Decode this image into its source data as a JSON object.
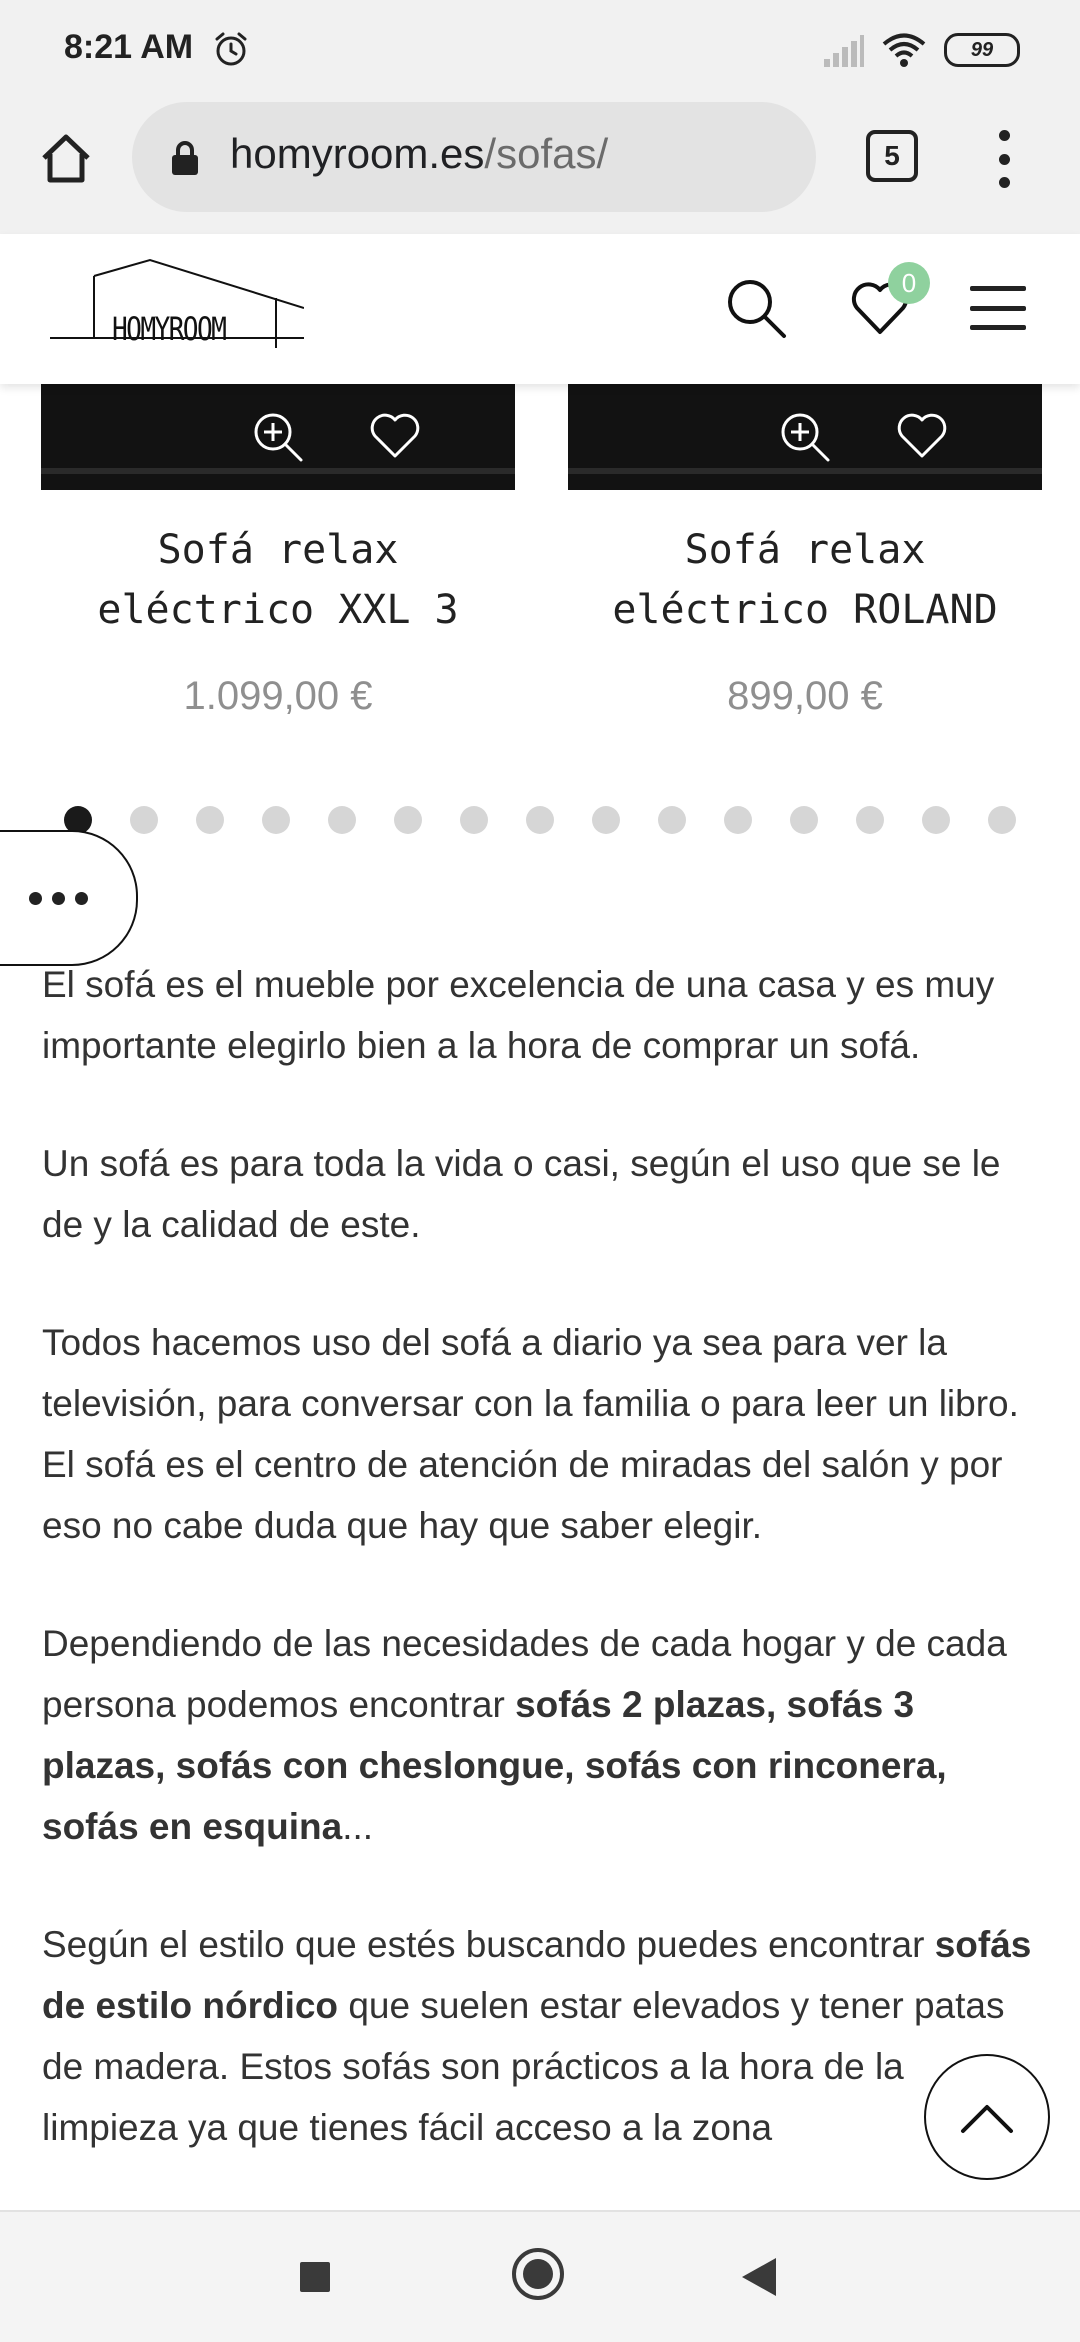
{
  "status_bar": {
    "time": "8:21 AM",
    "battery": "99"
  },
  "browser": {
    "url_host": "homyroom.es",
    "url_path": "/sofas/",
    "tab_count": "5"
  },
  "site_header": {
    "logo_text": "HOMYROOM",
    "wishlist_count": "0"
  },
  "products": [
    {
      "name": "Sofá relax\neléctrico XXL 3",
      "price": "1.099,00 €"
    },
    {
      "name": "Sofá relax\neléctrico ROLAND",
      "price": "899,00 €"
    }
  ],
  "carousel": {
    "total_dots": 15,
    "active_index": 0
  },
  "article": {
    "paragraphs": [
      [
        {
          "text": "El sofá es el mueble por excelencia de una casa y es muy importante elegirlo bien a la hora de comprar un sofá."
        }
      ],
      [
        {
          "text": "Un sofá es para toda la vida o casi, según el uso que se le de y la calidad de este."
        }
      ],
      [
        {
          "text": "Todos hacemos uso del sofá a diario ya sea para ver la televisión, para conversar con la familia o para leer un libro. El sofá es el centro de atención de miradas del salón y por eso no cabe duda que hay que saber elegir."
        }
      ],
      [
        {
          "text": "Dependiendo de las necesidades de cada hogar y de cada persona podemos encontrar "
        },
        {
          "text": "sofás 2 plazas, sofás 3 plazas, sofás con cheslongue, sofás con rinconera, sofás en esquina",
          "bold": true
        },
        {
          "text": "..."
        }
      ],
      [
        {
          "text": "Según el estilo que estés buscando puedes encontrar "
        },
        {
          "text": "sofás de estilo nórdico",
          "bold": true
        },
        {
          "text": " que suelen estar elevados y tener patas de madera. Estos sofás son prácticos a la hora de la limpieza ya que tienes fácil acceso a la zona"
        }
      ]
    ]
  },
  "icons": {
    "home": "home-icon",
    "lock": "lock-icon",
    "search": "search-icon",
    "wishlist": "heart-icon",
    "menu": "hamburger-menu-icon",
    "zoom": "zoom-in-icon",
    "more": "more-horizontal-icon",
    "back_to_top": "chevron-up-icon"
  },
  "colors": {
    "badge": "#8fd19e",
    "price": "#8f8f8f",
    "dot_active": "#1a1a1a",
    "dot_inactive": "#d6d6d6"
  }
}
